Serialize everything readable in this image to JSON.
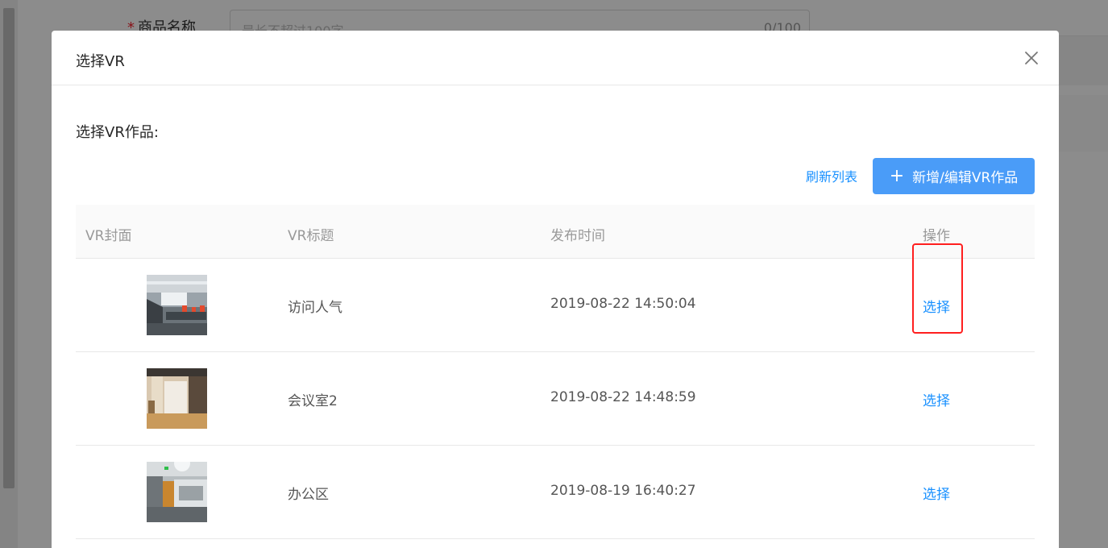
{
  "background": {
    "required_mark": "*",
    "field_label": "商品名称",
    "field_placeholder": "最长不超过100字",
    "field_counter": "0/100"
  },
  "modal": {
    "title": "选择VR",
    "section_label": "选择VR作品:",
    "refresh_label": "刷新列表",
    "add_label": "新增/编辑VR作品",
    "add_icon": "plus-icon",
    "close_icon": "close-icon"
  },
  "table": {
    "headers": {
      "cover": "VR封面",
      "title": "VR标题",
      "time": "发布时间",
      "action": "操作"
    },
    "rows": [
      {
        "title": "访问人气",
        "time": "2019-08-22 14:50:04",
        "action": "选择"
      },
      {
        "title": "会议室2",
        "time": "2019-08-22 14:48:59",
        "action": "选择"
      },
      {
        "title": "办公区",
        "time": "2019-08-19 16:40:27",
        "action": "选择"
      }
    ]
  },
  "colors": {
    "primary": "#1890ff",
    "button_bg": "#4a9cf8",
    "highlight": "#ff1f1f"
  }
}
